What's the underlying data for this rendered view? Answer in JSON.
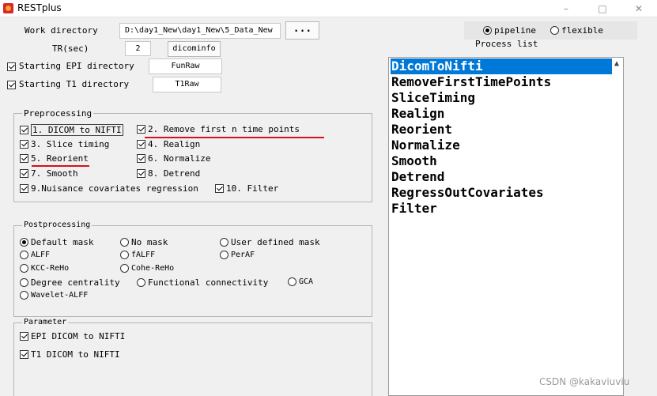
{
  "window": {
    "title": "RESTplus",
    "minimize": "–",
    "maximize": "□",
    "close": "✕"
  },
  "settings": {
    "work_dir_label": "Work directory",
    "work_dir_value": "D:\\day1_New\\day1_New\\5_Data_New",
    "browse_label": "...",
    "tr_label": "TR(sec)",
    "tr_value": "2",
    "dicominfo_label": "dicominfo",
    "epi_label": "Starting EPI directory",
    "epi_value": "FunRaw",
    "t1_label": "Starting T1 directory",
    "t1_value": "T1Raw"
  },
  "mode": {
    "pipeline_label": "pipeline",
    "flexible_label": "flexible",
    "selected": "pipeline"
  },
  "process_list": {
    "title": "Process list",
    "items": [
      "DicomToNifti",
      "RemoveFirstTimePoints",
      "SliceTiming",
      "Realign",
      "Reorient",
      "Normalize",
      "Smooth",
      "Detrend",
      "RegressOutCovariates",
      "Filter"
    ],
    "selected_index": 0
  },
  "preprocessing": {
    "title": "Preprocessing",
    "items": [
      "1. DICOM to NIFTI",
      "2. Remove first n time points",
      "3. Slice timing",
      "4. Realign",
      "5. Reorient",
      "6. Normalize",
      "7. Smooth",
      "8. Detrend",
      "9.Nuisance covariates regression",
      "10. Filter"
    ],
    "checked": [
      true,
      true,
      true,
      true,
      true,
      true,
      true,
      true,
      true,
      true
    ]
  },
  "postprocessing": {
    "title": "Postprocessing",
    "options": [
      "Default mask",
      "No mask",
      "User defined mask",
      "ALFF",
      "fALFF",
      "PerAF",
      "KCC-ReHo",
      "Cohe-ReHo",
      "Degree centrality",
      "Functional connectivity",
      "GCA",
      "Wavelet-ALFF"
    ],
    "selected": "Default mask"
  },
  "parameter": {
    "title": "Parameter",
    "items": [
      "EPI DICOM to NIFTI",
      "T1 DICOM to NIFTI"
    ],
    "checked": [
      true,
      true
    ]
  },
  "watermark": "CSDN @kakaviuviu",
  "colors": {
    "selection": "#0078d7",
    "annotation_red": "#d6101f",
    "background": "#f0f0f0"
  }
}
